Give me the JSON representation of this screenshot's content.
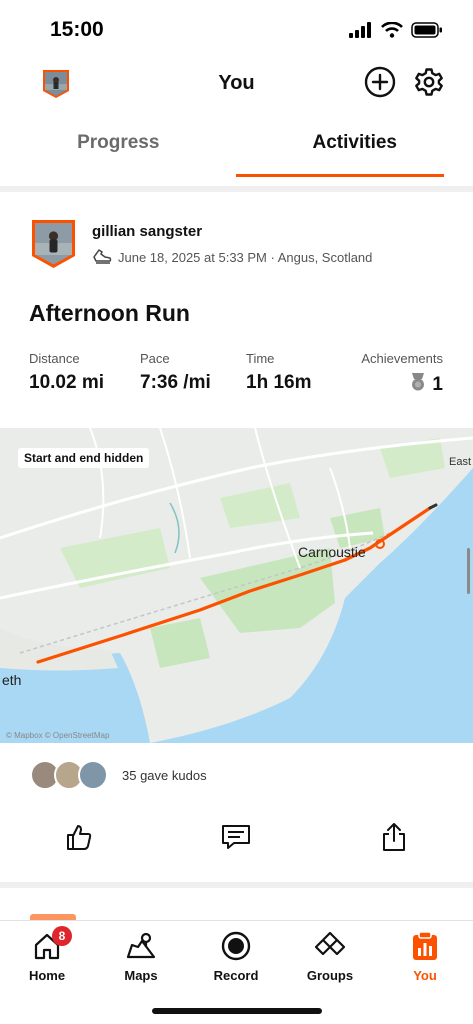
{
  "status_bar": {
    "time": "15:00"
  },
  "header": {
    "title": "You"
  },
  "tabs": [
    {
      "label": "Progress",
      "active": false
    },
    {
      "label": "Activities",
      "active": true
    }
  ],
  "activity": {
    "athlete_name": "gillian sangster",
    "meta": "June 18, 2025 at 5:33 PM · Angus, Scotland",
    "title": "Afternoon Run",
    "stats": [
      {
        "label": "Distance",
        "value": "10.02 mi"
      },
      {
        "label": "Pace",
        "value": "7:36 /mi"
      },
      {
        "label": "Time",
        "value": "1h 16m"
      }
    ],
    "achievements": {
      "label": "Achievements",
      "value": "1"
    }
  },
  "map": {
    "badge": "Start and end hidden",
    "labels": {
      "carnoustie": "Carnoustie",
      "east": "East",
      "eth": "eth"
    },
    "attribution": "© Mapbox © OpenStreetMap",
    "route_color": "#fc5200"
  },
  "kudos": {
    "text": "35 gave kudos"
  },
  "bottom_nav": [
    {
      "label": "Home",
      "icon": "home-icon",
      "badge": "8"
    },
    {
      "label": "Maps",
      "icon": "map-icon"
    },
    {
      "label": "Record",
      "icon": "record-icon"
    },
    {
      "label": "Groups",
      "icon": "groups-icon"
    },
    {
      "label": "You",
      "icon": "you-icon",
      "active": true
    }
  ],
  "colors": {
    "accent": "#fc5200",
    "badge": "#e0262d",
    "water": "#a8d8f4",
    "land": "#e9ece8",
    "park": "#c8e6bd"
  }
}
